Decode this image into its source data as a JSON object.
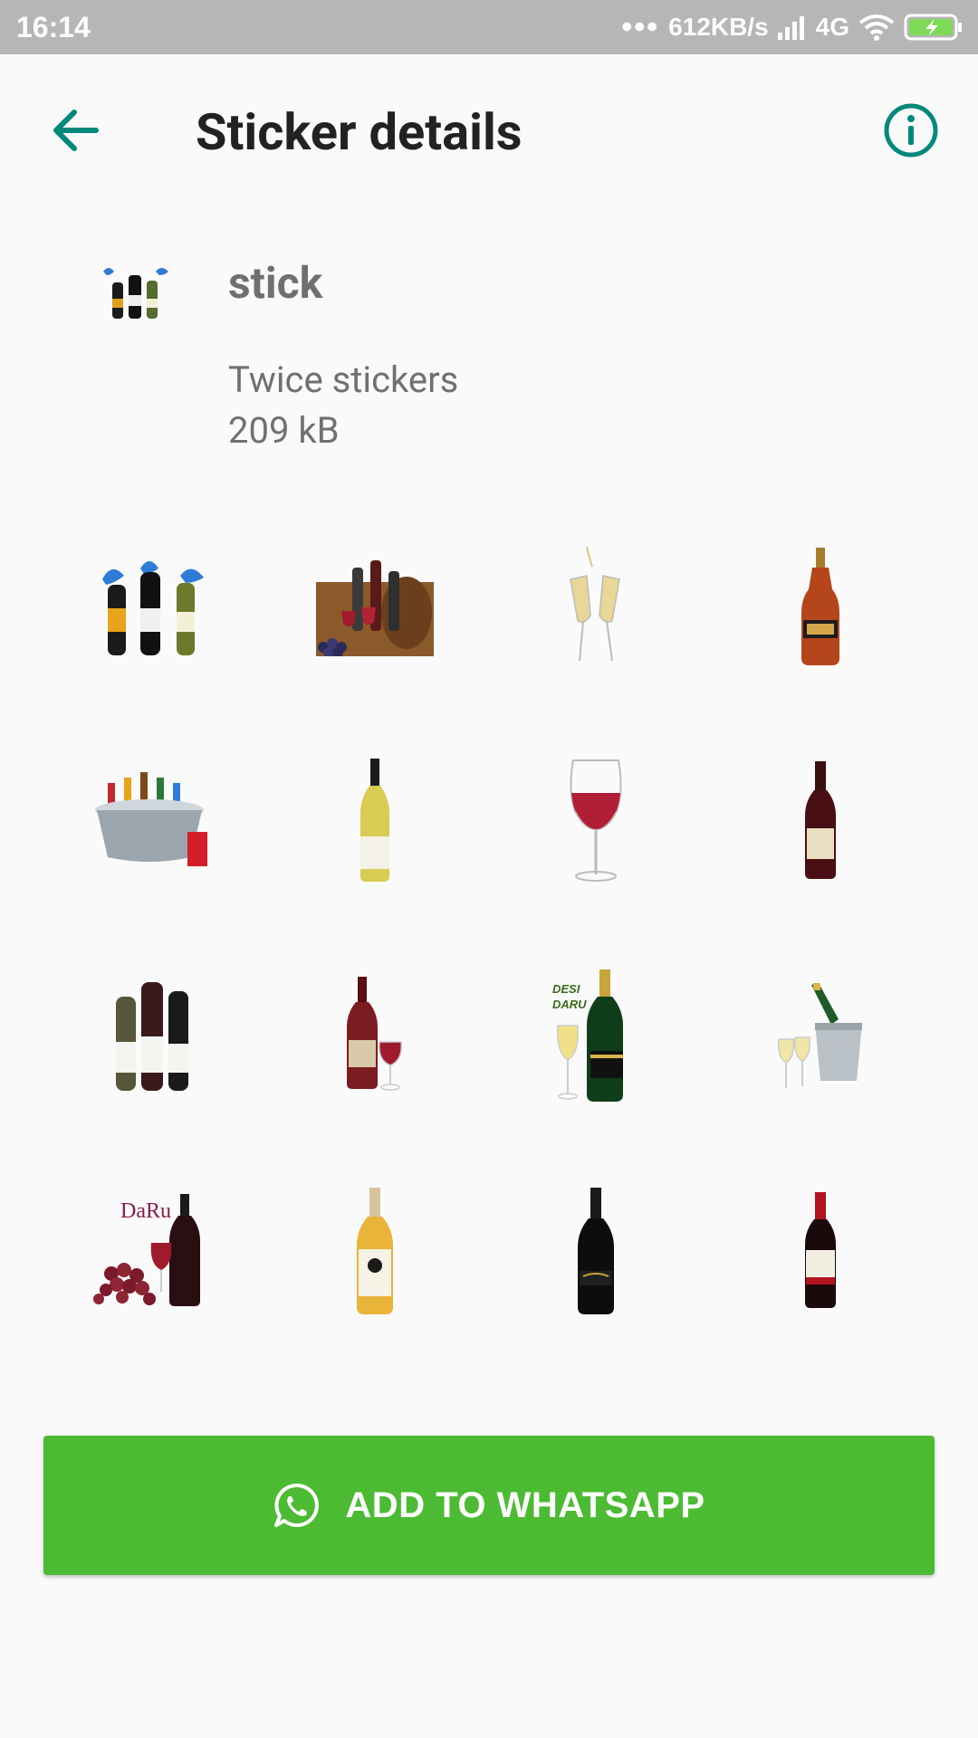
{
  "status_bar": {
    "time": "16:14",
    "network_speed": "612KB/s",
    "network_type": "4G",
    "icons": [
      "dots-icon",
      "signal-icon",
      "wifi-icon",
      "battery-charging-icon"
    ]
  },
  "app_bar": {
    "title": "Sticker details",
    "back_icon": "arrow-back-icon",
    "info_icon": "info-icon"
  },
  "pack": {
    "name": "stick",
    "publisher": "Twice stickers",
    "size": "209 kB"
  },
  "stickers": [
    "wine-bottles-with-wings",
    "wine-barrel-with-grapes",
    "champagne-toast",
    "cognac-bottle",
    "ice-bucket-with-drinks",
    "white-wine-bottle",
    "red-wine-glass",
    "red-wine-bottle",
    "three-wine-bottles",
    "red-wine-bottle-and-glass",
    "desi-daru-champagne",
    "champagne-ice-bucket",
    "daru-wine-with-grapes",
    "white-label-bottle",
    "dark-sparkling-bottle",
    "red-label-wine-bottle"
  ],
  "sticker_texts": {
    "desi_daru": "DESI\nDARU",
    "daru_logo": "DaRu"
  },
  "add_button": {
    "label": "ADD TO WHATSAPP",
    "icon": "whatsapp-icon"
  },
  "colors": {
    "accent": "#00897b",
    "button": "#4cbb33",
    "status_bar": "#b6b6b6"
  }
}
